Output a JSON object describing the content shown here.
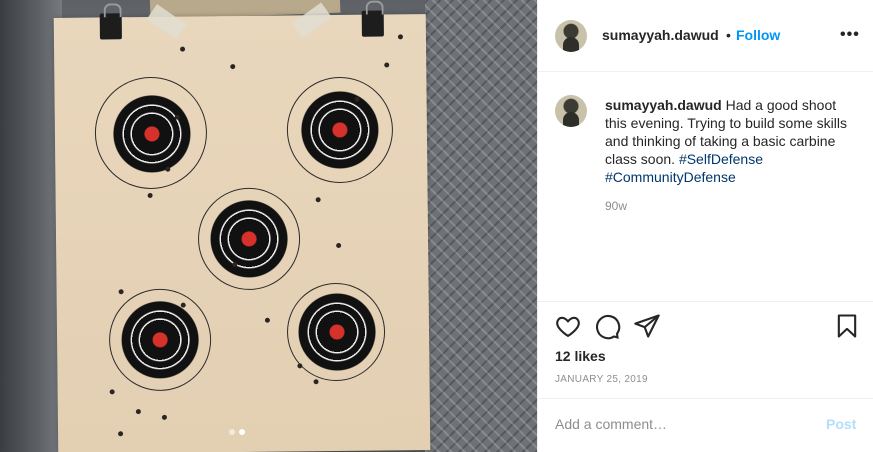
{
  "header": {
    "username": "sumayyah.dawud",
    "separator": "•",
    "follow_label": "Follow",
    "more_icon": "more-options-icon",
    "more_glyph": "•••"
  },
  "post": {
    "caption_user": "sumayyah.dawud",
    "caption_text": "Had a good shoot this evening. Trying to build some skills and thinking of taking a basic carbine class soon.",
    "hashtags": [
      "#SelfDefense",
      "#CommunityDefense"
    ],
    "time_ago": "90w",
    "likes": "12 likes",
    "date": "JANUARY 25, 2019"
  },
  "actions": {
    "like_icon": "heart-icon",
    "comment_icon": "comment-icon",
    "share_icon": "share-icon",
    "save_icon": "bookmark-icon"
  },
  "comment_box": {
    "placeholder": "Add a comment…",
    "post_label": "Post"
  },
  "carousel": {
    "slide_count": 2,
    "active_slide": 2
  },
  "colors": {
    "link_blue": "#0095f6",
    "hashtag": "#00376b",
    "muted": "#8e8e8e",
    "post_disabled": "#b2dffc",
    "target_red": "#d7312c"
  }
}
